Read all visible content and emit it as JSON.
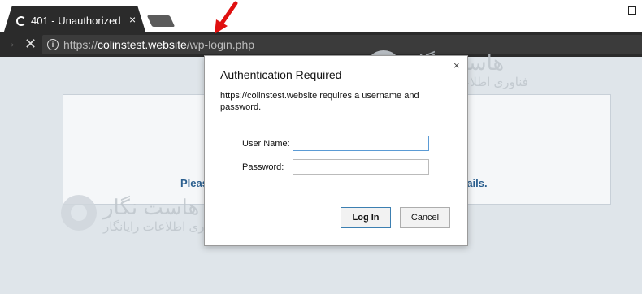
{
  "tab": {
    "title": "401 - Unauthorized",
    "close": "×"
  },
  "window": {
    "minimize": "",
    "maximize": ""
  },
  "toolbar": {
    "forward": "→",
    "stop": "✕",
    "url_scheme": "https://",
    "url_host": "colinstest.website",
    "url_path": "/wp-login.php"
  },
  "page": {
    "left_text": "Pleas",
    "right_text": "tails."
  },
  "watermark": {
    "line1": "هاست نگار",
    "line2": "فناوری اطلاعات رایانگار"
  },
  "dialog": {
    "close": "×",
    "title": "Authentication Required",
    "message": "https://colinstest.website requires a username and password.",
    "username_label": "User Name:",
    "username_value": "",
    "password_label": "Password:",
    "password_value": "",
    "login_label": "Log In",
    "cancel_label": "Cancel"
  },
  "colors": {
    "annotation_arrow": "#e01010",
    "link_text": "#2b5f8f"
  }
}
